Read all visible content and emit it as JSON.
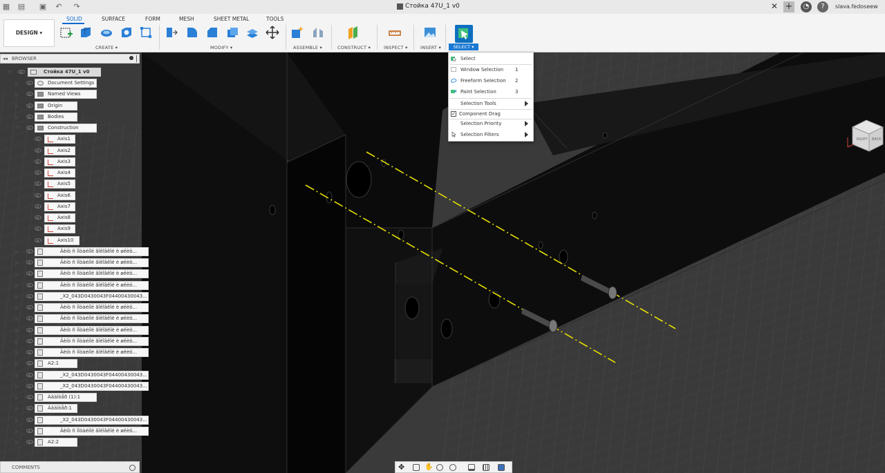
{
  "window": {
    "title": "Стойка 47U_1 v0",
    "user": "slava.fedoseew"
  },
  "toolbar": {
    "workspace": "DESIGN ▾",
    "tabs": [
      "SOLID",
      "SURFACE",
      "FORM",
      "MESH",
      "SHEET METAL",
      "TOOLS"
    ],
    "groups": {
      "create": "CREATE ▾",
      "modify": "MODIFY ▾",
      "assemble": "ASSEMBLE ▾",
      "construct": "CONSTRUCT ▾",
      "inspect": "INSPECT ▾",
      "insert": "INSERT ▾",
      "select": "SELECT ▾"
    }
  },
  "browser": {
    "title": "BROWSER",
    "root": "Стойка 47U_1 v0",
    "items": [
      {
        "label": "Document Settings"
      },
      {
        "label": "Named Views"
      },
      {
        "label": "Origin"
      },
      {
        "label": "Bodies"
      },
      {
        "label": "Construction"
      },
      {
        "label": "Axis1"
      },
      {
        "label": "Axis2"
      },
      {
        "label": "Axis3"
      },
      {
        "label": "Axis4"
      },
      {
        "label": "Axis5"
      },
      {
        "label": "Axis6"
      },
      {
        "label": "Axis7"
      },
      {
        "label": "Axis8"
      },
      {
        "label": "Axis9"
      },
      {
        "label": "Axis10"
      },
      {
        "label": "Âèíò ñ ïîòàéíîé ãîëîâêîé è øëèö..."
      },
      {
        "label": "Âèíò ñ ïîòàéíîé ãîëîâêîé è øëèö..."
      },
      {
        "label": "Âèíò ñ ïîòàéíîé ãîëîâêîé è øëèö..."
      },
      {
        "label": "Âèíò ñ ïîòàéíîé ãîëîâêîé è øëèö..."
      },
      {
        "label": "_X2_043D0430043F04400430043..."
      },
      {
        "label": "Âèíò ñ ïîòàéíîé ãîëîâêîé è øëèö..."
      },
      {
        "label": "Âèíò ñ ïîòàéíîé ãîëîâêîé è øëèö..."
      },
      {
        "label": "Âèíò ñ ïîòàéíîé ãîëîâêîé è øëèö..."
      },
      {
        "label": "Âèíò ñ ïîòàéíîé ãîëîâêîé è øëèö..."
      },
      {
        "label": "Âèíò ñ ïîòàéíîé ãîëîâêîé è øëèö..."
      },
      {
        "label": "A2:1"
      },
      {
        "label": "_X2_043D0430043F04400430043..."
      },
      {
        "label": "_X2_043D0430043F04400430043..."
      },
      {
        "label": "Àäàïòåð (1):1"
      },
      {
        "label": "Àäàïòåð:1"
      },
      {
        "label": "_X2_043D0430043F04400430043..."
      },
      {
        "label": "Âèíò ñ ïîòàéíîé ãîëîâêîé è øëèö..."
      },
      {
        "label": "A2:2"
      }
    ],
    "comments": "COMMENTS"
  },
  "select_menu": {
    "items": [
      {
        "label": "Select",
        "key": ""
      },
      {
        "label": "Window Selection",
        "key": "1"
      },
      {
        "label": "Freeform Selection",
        "key": "2"
      },
      {
        "label": "Paint Selection",
        "key": "3"
      },
      {
        "label": "Selection Tools",
        "key": ""
      },
      {
        "label": "Component Drag",
        "key": ""
      },
      {
        "label": "Selection Priority",
        "key": ""
      },
      {
        "label": "Selection Filters",
        "key": ""
      }
    ]
  },
  "viewcube": {
    "faces": [
      "RIGHT",
      "BACK"
    ]
  },
  "colors": {
    "accent": "#0a6ad0",
    "axis": "#e8e000",
    "model": "#0d0d0d"
  }
}
